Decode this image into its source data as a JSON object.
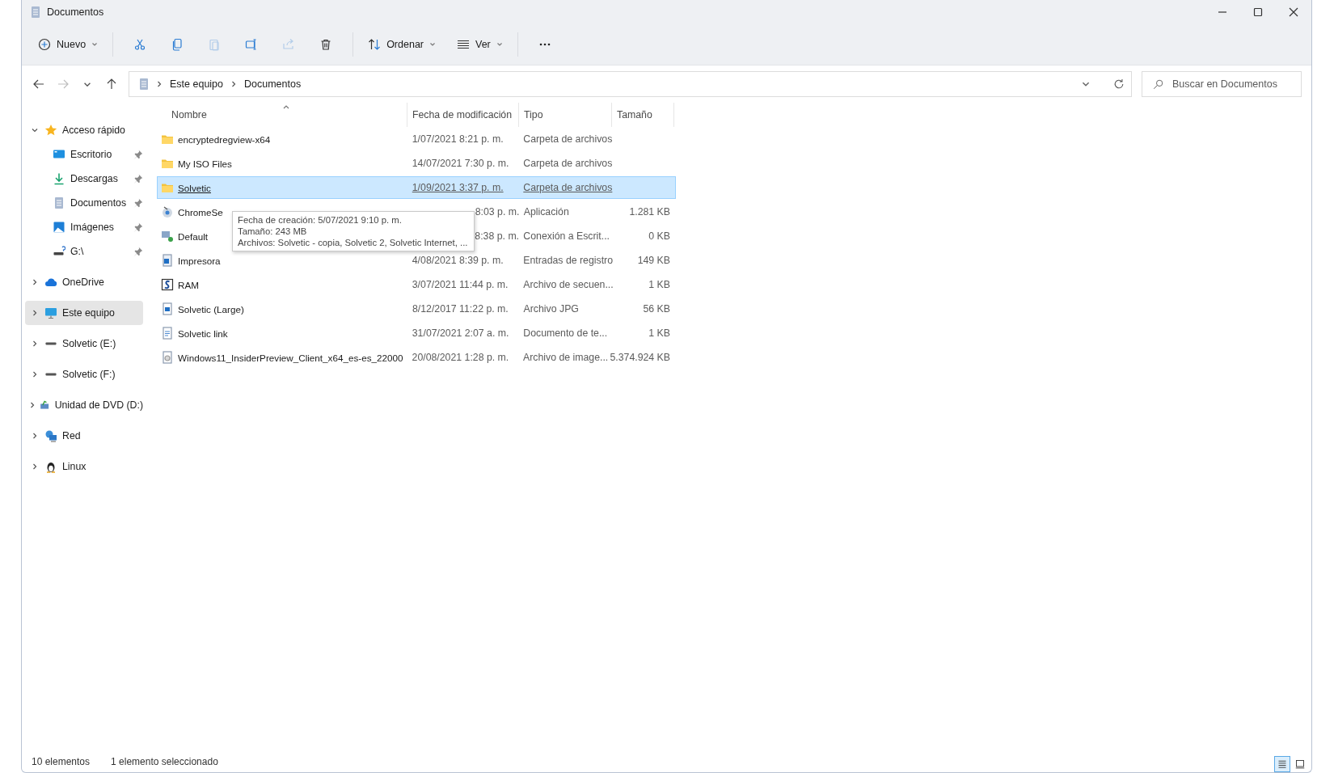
{
  "window": {
    "title": "Documentos"
  },
  "toolbar": {
    "new_label": "Nuevo",
    "sort_label": "Ordenar",
    "view_label": "Ver",
    "actions": [
      {
        "disabled": false
      },
      {
        "disabled": false
      },
      {
        "disabled": true
      },
      {
        "disabled": false
      },
      {
        "disabled": true
      },
      {
        "disabled": false
      }
    ]
  },
  "nav": {
    "back_disabled": false,
    "forward_disabled": true
  },
  "address": {
    "path": [
      "Este equipo",
      "Documentos"
    ]
  },
  "search": {
    "placeholder": "Buscar en Documentos"
  },
  "sidebar": {
    "items": [
      {
        "label": "Acceso rápido",
        "expanded": true,
        "selected": false,
        "children": [
          {
            "label": "Escritorio",
            "pinned": true
          },
          {
            "label": "Descargas",
            "pinned": true
          },
          {
            "label": "Documentos",
            "pinned": true
          },
          {
            "label": "Imágenes",
            "pinned": true
          },
          {
            "label": "G:\\",
            "pinned": true
          }
        ]
      },
      {
        "label": "OneDrive",
        "expanded": false,
        "selected": false
      },
      {
        "label": "Este equipo",
        "expanded": false,
        "selected": true
      },
      {
        "label": "Solvetic (E:)",
        "expanded": false,
        "selected": false
      },
      {
        "label": "Solvetic (F:)",
        "expanded": false,
        "selected": false
      },
      {
        "label": "Unidad de DVD (D:)",
        "expanded": false,
        "selected": false
      },
      {
        "label": "Red",
        "expanded": false,
        "selected": false
      },
      {
        "label": "Linux",
        "expanded": false,
        "selected": false
      }
    ]
  },
  "table": {
    "columns": [
      {
        "label": "Nombre",
        "sorted": true
      },
      {
        "label": "Fecha de modificación",
        "sorted": false
      },
      {
        "label": "Tipo",
        "sorted": false
      },
      {
        "label": "Tamaño",
        "sorted": false
      }
    ],
    "rows": [
      {
        "kind": "folder",
        "name": "encryptedregview-x64",
        "date": "1/07/2021 8:21 p. m.",
        "type": "Carpeta de archivos",
        "selected": false
      },
      {
        "kind": "folder",
        "name": "My ISO Files",
        "date": "14/07/2021 7:30 p. m.",
        "type": "Carpeta de archivos",
        "selected": false
      },
      {
        "kind": "folder",
        "name": "Solvetic",
        "date": "1/09/2021 3:37 p. m.",
        "type": "Carpeta de archivos",
        "selected": true
      },
      {
        "kind": "app",
        "name": "ChromeSe",
        "date": "8:03 p. m.",
        "type": "Aplicación",
        "size": "1.281 KB",
        "selected": false,
        "covered": true
      },
      {
        "kind": "remote",
        "name": "Default",
        "date": "8:38 p. m.",
        "type": "Conexión a Escrit...",
        "size": "0 KB",
        "selected": false,
        "covered": true
      },
      {
        "kind": "registry",
        "name": "Impresora",
        "date": "4/08/2021 8:39 p. m.",
        "type": "Entradas de registro",
        "size": "149 KB",
        "selected": false
      },
      {
        "kind": "script",
        "name": "RAM",
        "date": "3/07/2021 11:44 p. m.",
        "type": "Archivo de secuen...",
        "size": "1 KB",
        "selected": false
      },
      {
        "kind": "image",
        "name": "Solvetic (Large)",
        "date": "8/12/2017 11:22 p. m.",
        "type": "Archivo JPG",
        "size": "56 KB",
        "selected": false
      },
      {
        "kind": "text",
        "name": "Solvetic link",
        "date": "31/07/2021 2:07 a. m.",
        "type": "Documento de te...",
        "size": "1 KB",
        "selected": false
      },
      {
        "kind": "disc",
        "name": "Windows11_InsiderPreview_Client_x64_es-es_22000",
        "date": "20/08/2021 1:28 p. m.",
        "type": "Archivo de image...",
        "size": "5.374.924 KB",
        "selected": false
      }
    ]
  },
  "tooltip": {
    "lines": [
      "Fecha de creación: 5/07/2021 9:10 p. m.",
      "Tamaño: 243 MB",
      "Archivos: Solvetic - copia, Solvetic 2, Solvetic Internet, ..."
    ]
  },
  "status_bar": {
    "items": [
      "10 elementos",
      "1 elemento seleccionado"
    ],
    "views": [
      {
        "selected": true
      },
      {
        "selected": false
      }
    ]
  }
}
